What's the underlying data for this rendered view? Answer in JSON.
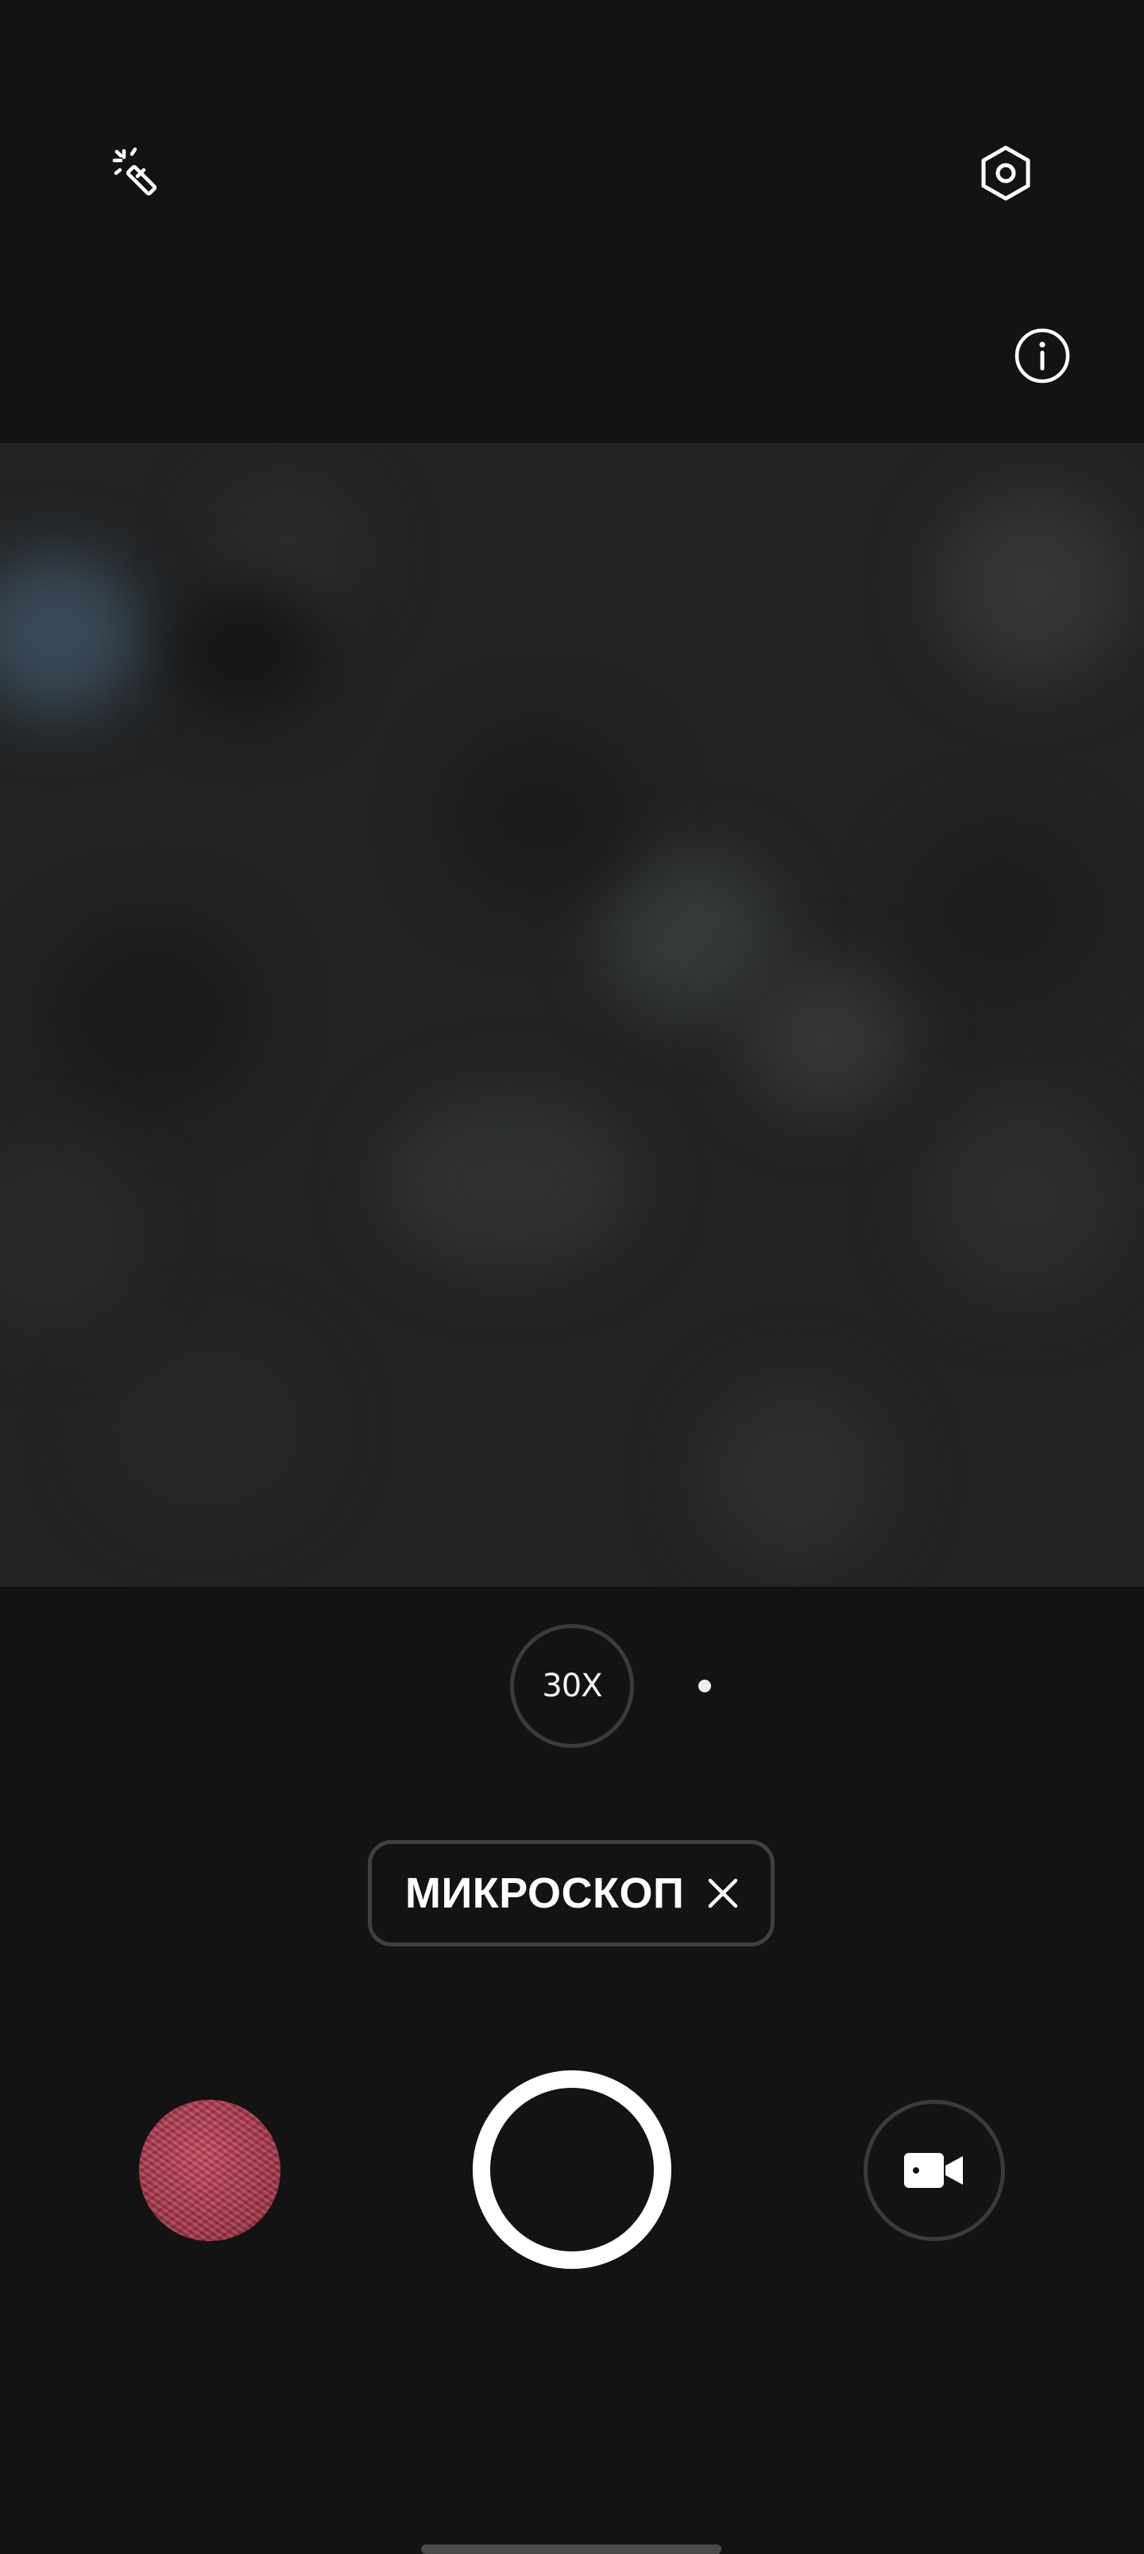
{
  "top_bar": {
    "icons": [
      "magic-wand-icon",
      "settings-hexagon-icon",
      "info-icon"
    ]
  },
  "viewfinder": {
    "description_icon": "camera-preview"
  },
  "zoom": {
    "level_label": "30X"
  },
  "mode": {
    "label": "МИКРОСКОП",
    "close_icon": "close-icon"
  },
  "bottom_controls": {
    "gallery_icon": "gallery-thumbnail",
    "shutter_icon": "shutter-button",
    "video_icon": "video-camera-icon"
  },
  "colors": {
    "background": "#131313",
    "viewfinder": "#222324",
    "thumbnail": "#b03c52",
    "ring_border": "#3b3b3b",
    "shutter": "#ffffff"
  }
}
